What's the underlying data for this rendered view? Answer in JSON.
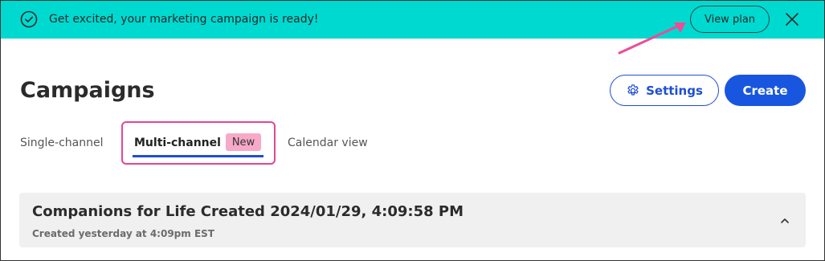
{
  "banner": {
    "message": "Get excited, your marketing campaign is ready!",
    "icon": "check-circle-icon",
    "action_label": "View plan",
    "close_icon": "close-icon",
    "background": "#00d9cf"
  },
  "header": {
    "title": "Campaigns",
    "settings_label": "Settings",
    "settings_icon": "gear-icon",
    "create_label": "Create"
  },
  "tabs": [
    {
      "label": "Single-channel",
      "active": false
    },
    {
      "label": "Multi-channel",
      "active": true,
      "badge": "New"
    },
    {
      "label": "Calendar view",
      "active": false
    }
  ],
  "campaigns": [
    {
      "title": "Companions for Life Created 2024/01/29, 4:09:58 PM",
      "subtitle": "Created yesterday at 4:09pm EST",
      "expanded": true
    }
  ],
  "colors": {
    "accent": "#1856e0",
    "highlight": "#e5468f",
    "badge": "#f7a9c8"
  }
}
